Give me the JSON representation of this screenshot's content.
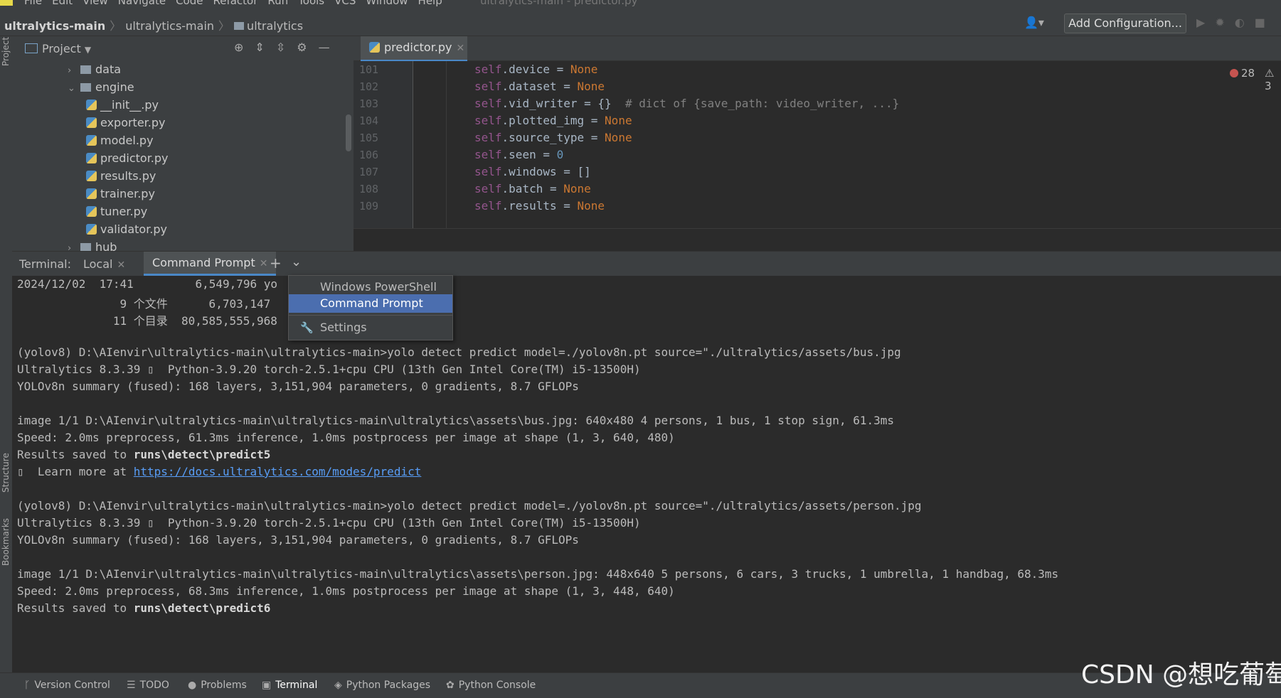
{
  "menu": {
    "items": [
      "File",
      "Edit",
      "View",
      "Navigate",
      "Code",
      "Refactor",
      "Run",
      "Tools",
      "VCS",
      "Window",
      "Help"
    ],
    "window_title": "ultralytics-main - predictor.py"
  },
  "navbar": {
    "project": "ultralytics-main",
    "crumb1": "ultralytics-main",
    "crumb2": "ultralytics",
    "add_configuration": "Add Configuration..."
  },
  "side_labels": {
    "project": "Project",
    "structure": "Structure",
    "bookmarks": "Bookmarks"
  },
  "project_panel": {
    "title": "Project",
    "tree": [
      {
        "label": "data",
        "type": "folder",
        "expanded": false
      },
      {
        "label": "engine",
        "type": "folder",
        "expanded": true
      },
      {
        "label": "__init__.py",
        "type": "file"
      },
      {
        "label": "exporter.py",
        "type": "file"
      },
      {
        "label": "model.py",
        "type": "file"
      },
      {
        "label": "predictor.py",
        "type": "file"
      },
      {
        "label": "results.py",
        "type": "file"
      },
      {
        "label": "trainer.py",
        "type": "file"
      },
      {
        "label": "tuner.py",
        "type": "file"
      },
      {
        "label": "validator.py",
        "type": "file"
      },
      {
        "label": "hub",
        "type": "folder",
        "expanded": false
      }
    ]
  },
  "editor": {
    "tab": "predictor.py",
    "errors": "28",
    "warnings": "3",
    "lines": [
      {
        "n": "101",
        "attr": "device",
        "val": "None",
        "vtype": "kw",
        "comment": ""
      },
      {
        "n": "102",
        "attr": "dataset",
        "val": "None",
        "vtype": "kw",
        "comment": ""
      },
      {
        "n": "103",
        "attr": "vid_writer",
        "val": "{}",
        "vtype": "plain",
        "comment": "# dict of {save_path: video_writer, ...}"
      },
      {
        "n": "104",
        "attr": "plotted_img",
        "val": "None",
        "vtype": "kw",
        "comment": ""
      },
      {
        "n": "105",
        "attr": "source_type",
        "val": "None",
        "vtype": "kw",
        "comment": ""
      },
      {
        "n": "106",
        "attr": "seen",
        "val": "0",
        "vtype": "num",
        "comment": ""
      },
      {
        "n": "107",
        "attr": "windows",
        "val": "[]",
        "vtype": "plain",
        "comment": ""
      },
      {
        "n": "108",
        "attr": "batch",
        "val": "None",
        "vtype": "kw",
        "comment": ""
      },
      {
        "n": "109",
        "attr": "results",
        "val": "None",
        "vtype": "kw",
        "comment": ""
      }
    ]
  },
  "terminal": {
    "label": "Terminal:",
    "tabs": [
      "Local",
      "Command Prompt"
    ],
    "lines": [
      {
        "text": "2024/12/02  17:41         6,549,796 yo"
      },
      {
        "text": "               9 个文件      6,703,147"
      },
      {
        "text": "              11 个目录  80,585,555,968"
      },
      {
        "text": ""
      },
      {
        "text": "(yolov8) D:\\AIenvir\\ultralytics-main\\ultralytics-main>yolo detect predict model=./yolov8n.pt source=\"./ultralytics/assets/bus.jpg"
      },
      {
        "text": "Ultralytics 8.3.39 ▯  Python-3.9.20 torch-2.5.1+cpu CPU (13th Gen Intel Core(TM) i5-13500H)"
      },
      {
        "text": "YOLOv8n summary (fused): 168 layers, 3,151,904 parameters, 0 gradients, 8.7 GFLOPs"
      },
      {
        "text": ""
      },
      {
        "text": "image 1/1 D:\\AIenvir\\ultralytics-main\\ultralytics-main\\ultralytics\\assets\\bus.jpg: 640x480 4 persons, 1 bus, 1 stop sign, 61.3ms"
      },
      {
        "text": "Speed: 2.0ms preprocess, 61.3ms inference, 1.0ms postprocess per image at shape (1, 3, 640, 480)"
      },
      {
        "prefix": "Results saved to ",
        "bold": "runs\\detect\\predict5"
      },
      {
        "prefix": "▯  Learn more at ",
        "link": "https://docs.ultralytics.com/modes/predict"
      },
      {
        "text": ""
      },
      {
        "text": "(yolov8) D:\\AIenvir\\ultralytics-main\\ultralytics-main>yolo detect predict model=./yolov8n.pt source=\"./ultralytics/assets/person.jpg"
      },
      {
        "text": "Ultralytics 8.3.39 ▯  Python-3.9.20 torch-2.5.1+cpu CPU (13th Gen Intel Core(TM) i5-13500H)"
      },
      {
        "text": "YOLOv8n summary (fused): 168 layers, 3,151,904 parameters, 0 gradients, 8.7 GFLOPs"
      },
      {
        "text": ""
      },
      {
        "text": "image 1/1 D:\\AIenvir\\ultralytics-main\\ultralytics-main\\ultralytics\\assets\\person.jpg: 448x640 5 persons, 6 cars, 3 trucks, 1 umbrella, 1 handbag, 68.3ms"
      },
      {
        "text": "Speed: 2.0ms preprocess, 68.3ms inference, 1.0ms postprocess per image at shape (1, 3, 448, 640)"
      },
      {
        "prefix": "Results saved to ",
        "bold": "runs\\detect\\predict6"
      }
    ]
  },
  "dropdown": {
    "options": [
      "Windows PowerShell",
      "Command Prompt",
      "Settings"
    ],
    "selected": "Command Prompt"
  },
  "bottom_tools": [
    "Version Control",
    "TODO",
    "Problems",
    "Terminal",
    "Python Packages",
    "Python Console"
  ],
  "watermark": "CSDN @想吃葡萄"
}
